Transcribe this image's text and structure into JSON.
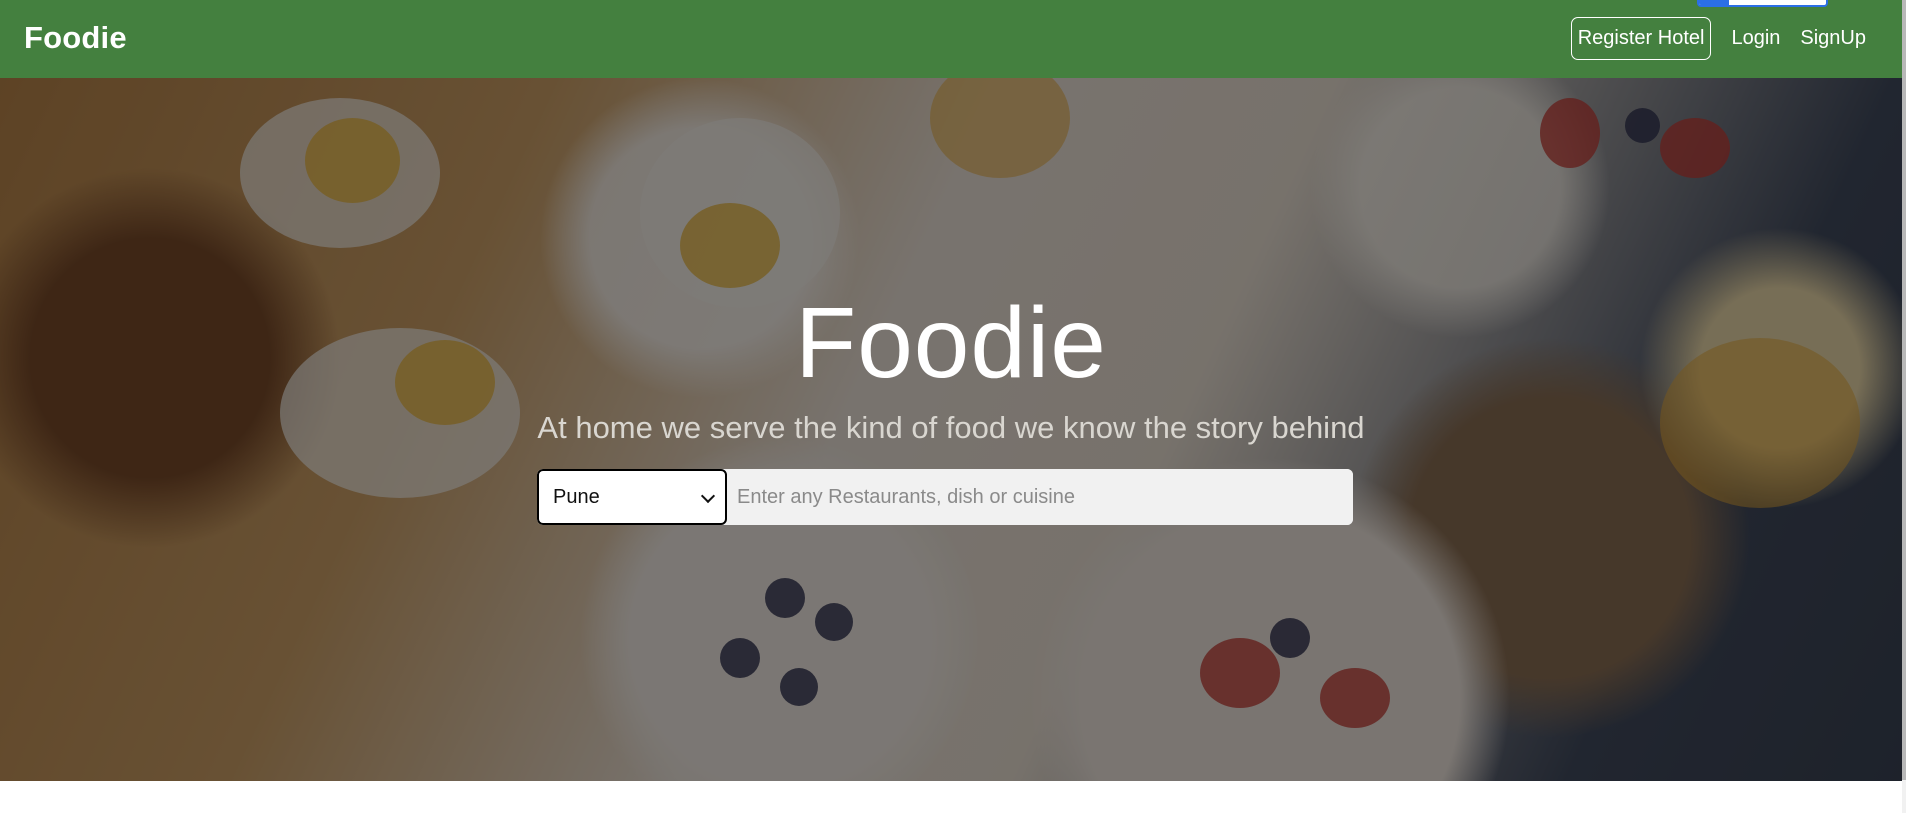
{
  "navbar": {
    "brand": "Foodie",
    "links": {
      "register_hotel": "Register Hotel",
      "login": "Login",
      "signup": "SignUp"
    },
    "bg_color": "#44803f"
  },
  "hero": {
    "title": "Foodie",
    "tagline": "At home we serve the kind of food we know the story behind",
    "search": {
      "city_selected": "Pune",
      "placeholder": "Enter any Restaurants, dish or cuisine"
    }
  }
}
